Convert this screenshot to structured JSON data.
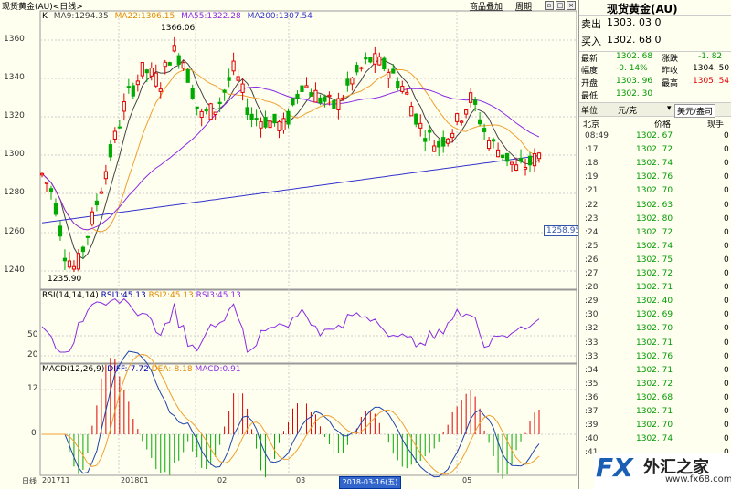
{
  "window": {
    "title": "现货黄金(AU)<日线>",
    "menu_overlay": "商品叠加",
    "menu_period": "周期"
  },
  "ma_legend": {
    "k": "K",
    "ma9": "MA9:1294.35",
    "ma22": "MA22:1306.15",
    "ma55": "MA55:1322.28",
    "ma200": "MA200:1307.54"
  },
  "annotations": {
    "high": "1366.06",
    "low": "1235.90",
    "last_price_tag": "1258.95"
  },
  "y_axis_main": [
    "1360",
    "1340",
    "1320",
    "1300",
    "1280",
    "1260",
    "1240"
  ],
  "rsi_info": {
    "name": "RSI(14,14,14)",
    "rsi1": "RSI1:45.13",
    "rsi2": "RSI2:45.13",
    "rsi3": "RSI3:45.13",
    "levels": [
      "50",
      "20"
    ]
  },
  "macd_info": {
    "name": "MACD(12,26,9)",
    "diff": "DIFF:-7.72",
    "dea": "DEA:-8.18",
    "macd": "MACD:0.91",
    "levels": [
      "12",
      "0"
    ]
  },
  "x_axis": {
    "period": "日线",
    "labels": [
      "201711",
      "201801",
      "02",
      "03",
      "05"
    ],
    "selected_date": "2018-03-16(五)"
  },
  "colors": {
    "up": "#e00000",
    "down": "#00aa00",
    "ma9": "#444444",
    "ma22": "#f0a030",
    "ma55": "#8a2be2",
    "ma200": "#3333cc"
  },
  "quote": {
    "name": "现货黄金(AU)",
    "sell_label": "卖出",
    "sell_value": "1303. 03 0",
    "buy_label": "买入",
    "buy_value": "1302. 68 0",
    "latest_label": "最新",
    "latest": "1302. 68",
    "change_label": "涨跌",
    "change": "-1. 82",
    "range_label": "幅度",
    "range": "-0. 14%",
    "prevclose_label": "昨收",
    "prevclose": "1304. 50",
    "open_label": "开盘",
    "open": "1303. 96",
    "high_label": "最高",
    "high": "1305. 54",
    "low_label": "最低",
    "low": "1302. 30",
    "unit_label": "单位",
    "unit_value": "元/克",
    "unit_alt": "美元/盎司",
    "col_location": "北京",
    "col_price": "价格",
    "col_volume": "现手"
  },
  "ticks": [
    {
      "time": "08:49",
      "price": "1302. 67",
      "vol": "0"
    },
    {
      "time": ":17",
      "price": "1302. 72",
      "vol": "0"
    },
    {
      "time": ":18",
      "price": "1302. 74",
      "vol": "0"
    },
    {
      "time": ":19",
      "price": "1302. 76",
      "vol": "0"
    },
    {
      "time": ":21",
      "price": "1302. 70",
      "vol": "0"
    },
    {
      "time": ":22",
      "price": "1302. 63",
      "vol": "0"
    },
    {
      "time": ":23",
      "price": "1302. 80",
      "vol": "0"
    },
    {
      "time": ":24",
      "price": "1302. 72",
      "vol": "0"
    },
    {
      "time": ":25",
      "price": "1302. 74",
      "vol": "0"
    },
    {
      "time": ":26",
      "price": "1302. 75",
      "vol": "0"
    },
    {
      "time": ":27",
      "price": "1302. 72",
      "vol": "0"
    },
    {
      "time": ":28",
      "price": "1302. 71",
      "vol": "0"
    },
    {
      "time": ":29",
      "price": "1302. 40",
      "vol": "0"
    },
    {
      "time": ":30",
      "price": "1302. 69",
      "vol": "0"
    },
    {
      "time": ":32",
      "price": "1302. 70",
      "vol": "0"
    },
    {
      "time": ":33",
      "price": "1302. 71",
      "vol": "0"
    },
    {
      "time": ":33",
      "price": "1302. 76",
      "vol": "0"
    },
    {
      "time": ":34",
      "price": "1302. 71",
      "vol": "0"
    },
    {
      "time": ":35",
      "price": "1302. 72",
      "vol": "0"
    },
    {
      "time": ":36",
      "price": "1302. 68",
      "vol": "0"
    },
    {
      "time": ":37",
      "price": "1302. 71",
      "vol": "0"
    },
    {
      "time": ":39",
      "price": "1302. 70",
      "vol": "0"
    },
    {
      "time": ":40",
      "price": "1302. 74",
      "vol": "0"
    },
    {
      "time": ":41",
      "price": "",
      "vol": "0"
    }
  ],
  "logo": {
    "fx": "FX",
    "name": "外汇之家",
    "url": "www.fx68.com"
  }
}
